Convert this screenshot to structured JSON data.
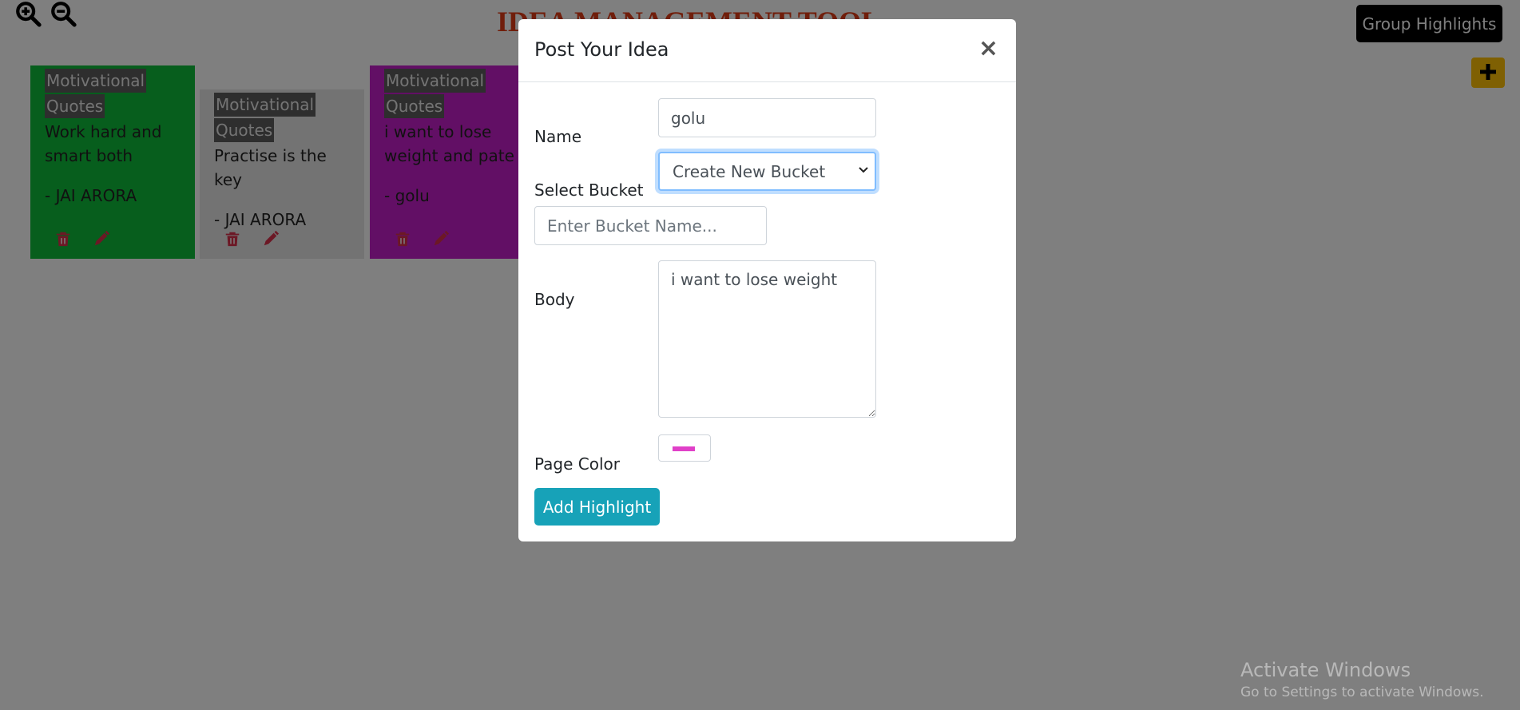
{
  "app": {
    "title": "IDEA MANAGEMENT TOOL",
    "group_button_label": "Group Highlights"
  },
  "icons": {
    "zoom_in": "zoom-in-icon",
    "zoom_out": "zoom-out-icon",
    "add": "plus-icon",
    "delete": "trash-icon",
    "edit": "pencil-icon"
  },
  "cards": [
    {
      "bucket": "Motivational Quotes",
      "body": "Work hard and smart both",
      "author": "- JAI ARORA",
      "color": "#0fbd3a"
    },
    {
      "bucket": "Motivational Quotes",
      "body": "Practise is the key",
      "author": "- JAI ARORA",
      "color": "#e6e6e6"
    },
    {
      "bucket": "Motivational Quotes",
      "body": "i want to lose weight and pate",
      "author": "- golu",
      "color": "#c51fcb"
    }
  ],
  "modal": {
    "title": "Post Your Idea",
    "close_symbol": "×",
    "name_label": "Name",
    "name_value": "golu",
    "bucket_label": "Select Bucket",
    "bucket_selected": "Create New Bucket",
    "bucket_name_placeholder": "Enter Bucket Name...",
    "body_label": "Body",
    "body_value": "i want to lose weight",
    "color_label": "Page Color",
    "color_value": "#e040c8",
    "submit_label": "Add Highlight"
  },
  "watermark": {
    "title": "Activate Windows",
    "subtitle": "Go to Settings to activate Windows."
  },
  "colors": {
    "title_red": "#e03c16",
    "overlay": "rgba(0,0,0,0.5)",
    "accent_teal": "#17a2b8",
    "fab_yellow": "#ffc107",
    "icon_red": "#d9304a"
  }
}
